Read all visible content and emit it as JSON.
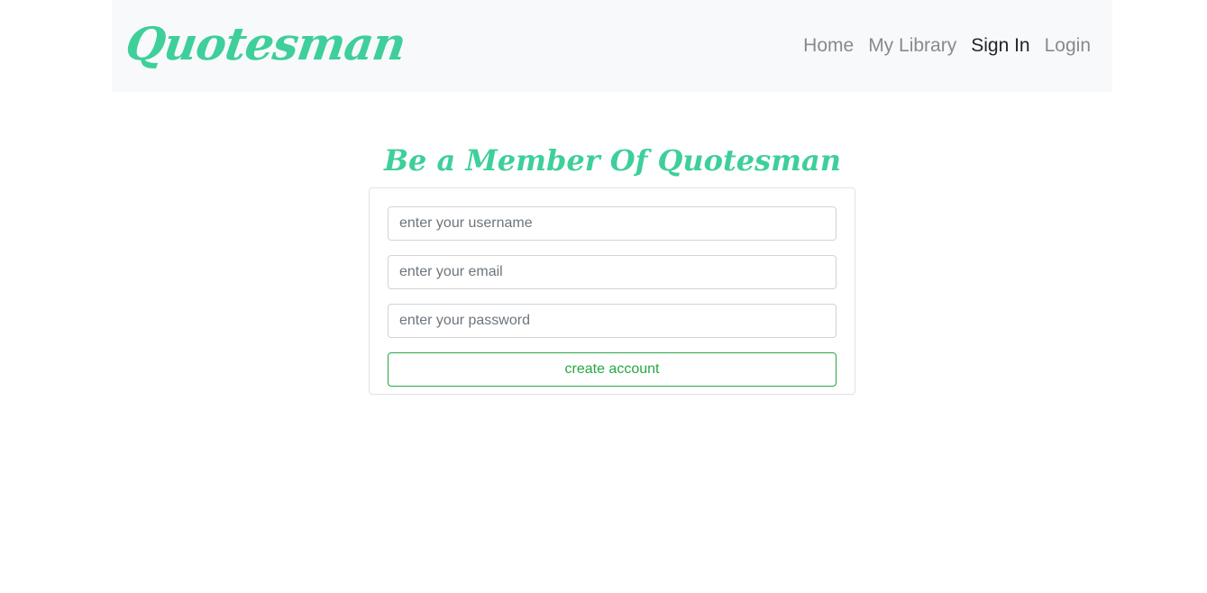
{
  "nav": {
    "brand": "Quotesman",
    "links": [
      {
        "label": "Home"
      },
      {
        "label": "My Library"
      },
      {
        "label": "Sign In"
      },
      {
        "label": "Login"
      }
    ]
  },
  "main": {
    "heading": "Be a Member Of Quotesman",
    "form": {
      "username_placeholder": "enter your username",
      "email_placeholder": "enter your email",
      "password_placeholder": "enter your password",
      "submit_label": "create account"
    }
  },
  "colors": {
    "brand": "#3ecf9a",
    "navbar_bg": "#f8f9fa",
    "button_outline": "#28a745"
  }
}
